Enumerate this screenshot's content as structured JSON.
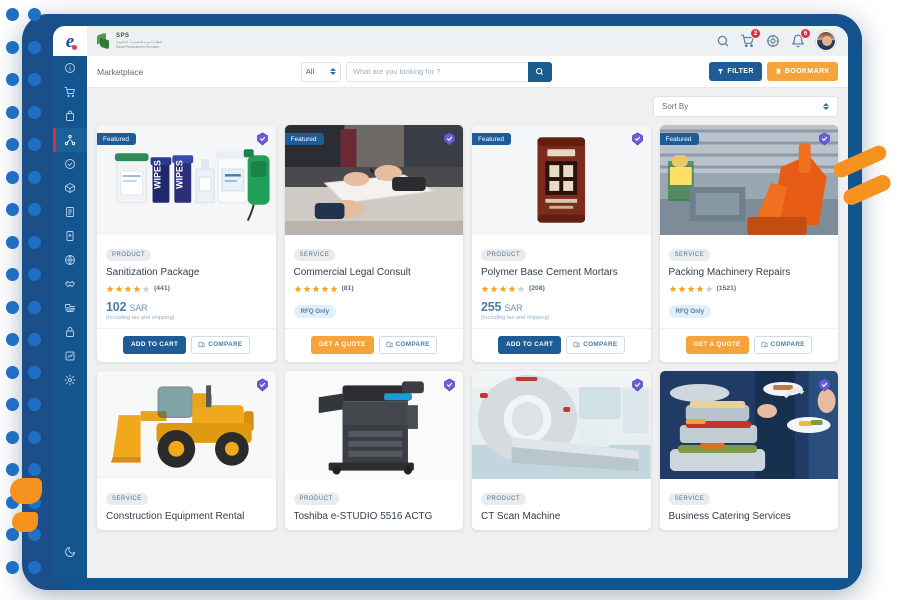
{
  "brand": {
    "logo_letter": "e",
    "abbr": "SPS",
    "sub_line1": "النظام الموحد للمشتريات الحكومية",
    "sub_line2": "Saudi Procurement Services"
  },
  "header": {
    "icons": [
      {
        "name": "search-icon",
        "badge": null
      },
      {
        "name": "cart-icon",
        "badge": "2"
      },
      {
        "name": "compass-icon",
        "badge": null
      },
      {
        "name": "bell-icon",
        "badge": "6"
      }
    ],
    "avatar_name": "user-avatar"
  },
  "toolbar": {
    "breadcrumb": "Marketplace",
    "category_value": "All",
    "search_placeholder": "What are you looking for ?",
    "search_value": "",
    "filter_label": "FILTER",
    "bookmark_label": "BOOKMARK"
  },
  "content": {
    "sort_label": "Sort By"
  },
  "sidebar": {
    "items": [
      {
        "icon": "info-icon",
        "label": "Information",
        "active": false
      },
      {
        "icon": "cart-icon",
        "label": "Purchases",
        "active": false
      },
      {
        "icon": "bag-icon",
        "label": "Orders",
        "active": false
      },
      {
        "icon": "network-icon",
        "label": "Marketplace",
        "active": true
      },
      {
        "icon": "check-circle-icon",
        "label": "Approvals",
        "active": false
      },
      {
        "icon": "box-icon",
        "label": "Inventory",
        "active": false
      },
      {
        "icon": "list-icon",
        "label": "Catalog",
        "active": false
      },
      {
        "icon": "file-icon",
        "label": "Documents",
        "active": false
      },
      {
        "icon": "globe-icon",
        "label": "Suppliers",
        "active": false
      },
      {
        "icon": "handshake-icon",
        "label": "Contracts",
        "active": false
      },
      {
        "icon": "data-icon",
        "label": "Reports",
        "active": false
      },
      {
        "icon": "lock-icon",
        "label": "Security",
        "active": false
      },
      {
        "icon": "chart-icon",
        "label": "Analytics",
        "active": false
      },
      {
        "icon": "gear-icon",
        "label": "Settings",
        "active": false
      }
    ],
    "theme_toggle": {
      "icon": "moon-icon",
      "label": "Dark mode"
    }
  },
  "labels": {
    "featured": "Featured",
    "verified": "Verified",
    "add_to_cart": "ADD TO CART",
    "get_a_quote": "GET A QUOTE",
    "compare": "COMPARE",
    "currency": "SAR",
    "price_note": "(Including tax and shipping)",
    "rfq_only": "RFQ Only"
  },
  "colors": {
    "primary_blue": "#1d5c96",
    "accent_orange": "#f6a33c",
    "star_gold": "#f5a623",
    "badge_red": "#e8293c",
    "price_blue": "#4a7ea8",
    "sidebar_blue": "#15558f"
  },
  "cards_row1": [
    {
      "featured": true,
      "verified": true,
      "type": "PRODUCT",
      "title": "Sanitization Package",
      "stars": 4,
      "reviews": "(441)",
      "price": "102",
      "currency": "SAR",
      "price_note": "(Including tax and shipping)",
      "rfq": null,
      "cta": "ADD TO CART",
      "compare": "COMPARE",
      "image": "sanitization-products"
    },
    {
      "featured": true,
      "verified": true,
      "type": "SERVICE",
      "title": "Commercial Legal Consult",
      "stars": 5,
      "reviews": "(81)",
      "price": null,
      "currency": null,
      "price_note": null,
      "rfq": "RFQ Only",
      "cta": "GET A QUOTE",
      "compare": "COMPARE",
      "image": "legal-consult-signing"
    },
    {
      "featured": true,
      "verified": true,
      "type": "PRODUCT",
      "title": "Polymer Base Cement Mortars",
      "stars": 4,
      "reviews": "(208)",
      "price": "255",
      "currency": "SAR",
      "price_note": "(Including tax and shipping)",
      "rfq": null,
      "cta": "ADD TO CART",
      "compare": "COMPARE",
      "image": "cement-mortar-bag"
    },
    {
      "featured": true,
      "verified": true,
      "type": "SERVICE",
      "title": "Packing Machinery Repairs",
      "stars": 4,
      "reviews": "(1521)",
      "price": null,
      "currency": null,
      "price_note": null,
      "rfq": "RFQ Only",
      "cta": "GET A QUOTE",
      "compare": "COMPARE",
      "image": "industrial-robot-arm"
    }
  ],
  "cards_row2": [
    {
      "featured": false,
      "verified": true,
      "type": "SERVICE",
      "title": "Construction Equipment Rental",
      "image": "wheel-loader"
    },
    {
      "featured": false,
      "verified": true,
      "type": "PRODUCT",
      "title": "Toshiba e-STUDIO 5516 ACTG",
      "image": "office-copier"
    },
    {
      "featured": false,
      "verified": true,
      "type": "PRODUCT",
      "title": "CT Scan Machine",
      "image": "ct-scanner"
    },
    {
      "featured": false,
      "verified": true,
      "type": "SERVICE",
      "title": "Business Catering Services",
      "image": "catering-buffet"
    }
  ]
}
